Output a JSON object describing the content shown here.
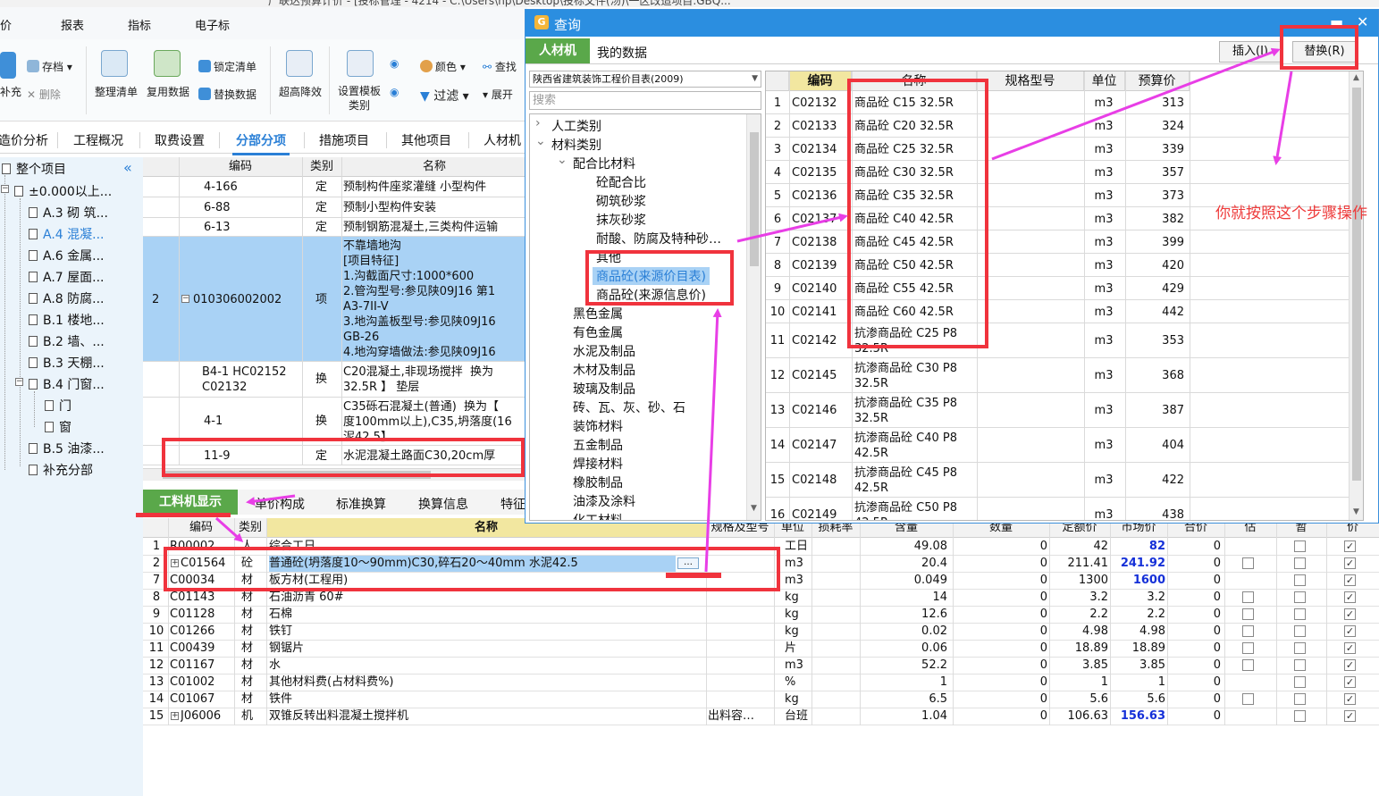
{
  "window_title": "广联达预算计价 - [投标管理 - 4214 - C:\\Users\\hp\\Desktop\\投标文件(汤)\\一区改造项目.GBQ...",
  "menu": [
    "价",
    "报表",
    "指标",
    "电子标"
  ],
  "ribbon": {
    "add": "补充",
    "save": "存档",
    "delete": "删除",
    "organize": "整理清单",
    "reuse": "复用数据",
    "lock": "锁定清单",
    "replace_data": "替换数据",
    "superior": "超高降效",
    "template": "设置模板\n类别",
    "color": "颜色",
    "filter": "过滤",
    "find": "查找",
    "expand": "展开"
  },
  "tabs": [
    "造价分析",
    "工程概况",
    "取费设置",
    "分部分项",
    "措施项目",
    "其他项目",
    "人材机"
  ],
  "active_tab": "分部分项",
  "tree": {
    "root": "整个项目",
    "items": [
      {
        "label": "±0.000以上..."
      },
      {
        "label": "A.3 砌 筑..."
      },
      {
        "label": "A.4 混凝..."
      },
      {
        "label": "A.6 金属..."
      },
      {
        "label": "A.7 屋面..."
      },
      {
        "label": "A.8 防腐..."
      },
      {
        "label": "B.1 楼地..."
      },
      {
        "label": "B.2 墙、..."
      },
      {
        "label": "B.3 天棚..."
      },
      {
        "label": "B.4 门窗..."
      },
      {
        "label": "门"
      },
      {
        "label": "窗"
      },
      {
        "label": "B.5 油漆..."
      },
      {
        "label": "补充分部"
      }
    ]
  },
  "center_grid": {
    "headers": [
      "编码",
      "类别",
      "名称"
    ],
    "rows": [
      {
        "no": "",
        "code": "4-166",
        "type": "定",
        "name": "预制构件座浆灌缝 小型构件"
      },
      {
        "no": "",
        "code": "6-88",
        "type": "定",
        "name": "预制小型构件安装"
      },
      {
        "no": "",
        "code": "6-13",
        "type": "定",
        "name": "预制钢筋混凝土,三类构件运输"
      },
      {
        "no": "2",
        "code": "010306002002",
        "type": "项",
        "name": "不靠墙地沟\n[项目特征]\n1.沟截面尺寸:1000*600\n2.管沟型号:参见陕09J16 第1\nA3-7II-V\n3.地沟盖板型号:参见陕09J16\nGB-26\n4.地沟穿墙做法:参见陕09J16"
      },
      {
        "no": "",
        "code": "B4-1 HC02152\nC02132",
        "type": "换",
        "name": "C20混凝土,非现场搅拌  换为\n32.5R 】 垫层"
      },
      {
        "no": "",
        "code": "4-1",
        "type": "换",
        "name": "C35砾石混凝土(普通)  换为【\n度100mm以上),C35,坍落度(16\n泥42.5】"
      },
      {
        "no": "",
        "code": "11-9",
        "type": "定",
        "name": "水泥混凝土路面C30,20cm厚"
      }
    ]
  },
  "bottom_tabs": [
    "工料机显示",
    "单价构成",
    "标准换算",
    "换算信息",
    "特征"
  ],
  "bottom_grid": {
    "headers": [
      "编码",
      "类别",
      "名称",
      "规格及型号",
      "单位",
      "损耗率",
      "含量",
      "数量",
      "定额价",
      "市场价",
      "合价",
      "估",
      "暂",
      "价"
    ],
    "rows": [
      {
        "no": "1",
        "code": "R00002",
        "type": "人",
        "name": "综合工日",
        "spec": "",
        "unit": "工日",
        "qty": "49.08",
        "amount": "0",
        "price": "42",
        "market": "82",
        "market_blue": true,
        "total": "0"
      },
      {
        "no": "2",
        "code": "C01564",
        "type": "砼",
        "name": "普通砼(坍落度10～90mm)C30,碎石20～40mm 水泥42.5",
        "spec": "",
        "unit": "m3",
        "qty": "20.4",
        "amount": "0",
        "price": "211.41",
        "market": "241.92",
        "market_blue": true,
        "total": "0"
      },
      {
        "no": "7",
        "code": "C00034",
        "type": "材",
        "name": "板方材(工程用)",
        "spec": "",
        "unit": "m3",
        "qty": "0.049",
        "amount": "0",
        "price": "1300",
        "market": "1600",
        "market_blue": true,
        "total": "0"
      },
      {
        "no": "8",
        "code": "C01143",
        "type": "材",
        "name": "石油沥青 60#",
        "spec": "",
        "unit": "kg",
        "qty": "14",
        "amount": "0",
        "price": "3.2",
        "market": "3.2",
        "market_blue": false,
        "total": "0"
      },
      {
        "no": "9",
        "code": "C01128",
        "type": "材",
        "name": "石棉",
        "spec": "",
        "unit": "kg",
        "qty": "12.6",
        "amount": "0",
        "price": "2.2",
        "market": "2.2",
        "market_blue": false,
        "total": "0"
      },
      {
        "no": "10",
        "code": "C01266",
        "type": "材",
        "name": "铁钉",
        "spec": "",
        "unit": "kg",
        "qty": "0.02",
        "amount": "0",
        "price": "4.98",
        "market": "4.98",
        "market_blue": false,
        "total": "0"
      },
      {
        "no": "11",
        "code": "C00439",
        "type": "材",
        "name": "钢锯片",
        "spec": "",
        "unit": "片",
        "qty": "0.06",
        "amount": "0",
        "price": "18.89",
        "market": "18.89",
        "market_blue": false,
        "total": "0"
      },
      {
        "no": "12",
        "code": "C01167",
        "type": "材",
        "name": "水",
        "spec": "",
        "unit": "m3",
        "qty": "52.2",
        "amount": "0",
        "price": "3.85",
        "market": "3.85",
        "market_blue": false,
        "total": "0"
      },
      {
        "no": "13",
        "code": "C01002",
        "type": "材",
        "name": "其他材料费(占材料费%)",
        "spec": "",
        "unit": "%",
        "qty": "1",
        "amount": "0",
        "price": "1",
        "market": "1",
        "market_blue": false,
        "total": "0"
      },
      {
        "no": "14",
        "code": "C01067",
        "type": "材",
        "name": "铁件",
        "spec": "",
        "unit": "kg",
        "qty": "6.5",
        "amount": "0",
        "price": "5.6",
        "market": "5.6",
        "market_blue": false,
        "total": "0"
      },
      {
        "no": "15",
        "code": "J06006",
        "type": "机",
        "name": "双锥反转出料混凝土搅拌机",
        "spec": "出料容…",
        "unit": "台班",
        "qty": "1.04",
        "amount": "0",
        "price": "106.63",
        "market": "156.63",
        "market_blue": true,
        "total": "0"
      }
    ],
    "ellipsis": "…"
  },
  "dialog": {
    "title": "查询",
    "tabs": [
      "人材机",
      "我的数据"
    ],
    "insert_label": "插入(I)",
    "replace_label": "替换(R)",
    "price_book": "陕西省建筑装饰工程价目表(2009)",
    "search_placeholder": "搜索",
    "tree": [
      {
        "label": "人工类别"
      },
      {
        "label": "材料类别"
      },
      {
        "label": "配合比材料"
      },
      {
        "label": "砼配合比"
      },
      {
        "label": "砌筑砂浆"
      },
      {
        "label": "抹灰砂浆"
      },
      {
        "label": "耐酸、防腐及特种砂…"
      },
      {
        "label": "其他"
      },
      {
        "label": "商品砼(来源价目表)"
      },
      {
        "label": "商品砼(来源信息价)"
      },
      {
        "label": "黑色金属"
      },
      {
        "label": "有色金属"
      },
      {
        "label": "水泥及制品"
      },
      {
        "label": "木材及制品"
      },
      {
        "label": "玻璃及制品"
      },
      {
        "label": "砖、瓦、灰、砂、石"
      },
      {
        "label": "装饰材料"
      },
      {
        "label": "五金制品"
      },
      {
        "label": "焊接材料"
      },
      {
        "label": "橡胶制品"
      },
      {
        "label": "油漆及涂料"
      },
      {
        "label": "化工材料"
      }
    ],
    "grid_headers": [
      "编码",
      "名称",
      "规格型号",
      "单位",
      "预算价"
    ],
    "rows": [
      {
        "no": "1",
        "code": "C02132",
        "name": "商品砼 C15 32.5R",
        "unit": "m3",
        "price": "313"
      },
      {
        "no": "2",
        "code": "C02133",
        "name": "商品砼 C20 32.5R",
        "unit": "m3",
        "price": "324"
      },
      {
        "no": "3",
        "code": "C02134",
        "name": "商品砼 C25 32.5R",
        "unit": "m3",
        "price": "339"
      },
      {
        "no": "4",
        "code": "C02135",
        "name": "商品砼 C30 32.5R",
        "unit": "m3",
        "price": "357"
      },
      {
        "no": "5",
        "code": "C02136",
        "name": "商品砼 C35 32.5R",
        "unit": "m3",
        "price": "373"
      },
      {
        "no": "6",
        "code": "C02137",
        "name": "商品砼 C40 42.5R",
        "unit": "m3",
        "price": "382"
      },
      {
        "no": "7",
        "code": "C02138",
        "name": "商品砼 C45 42.5R",
        "unit": "m3",
        "price": "399"
      },
      {
        "no": "8",
        "code": "C02139",
        "name": "商品砼 C50 42.5R",
        "unit": "m3",
        "price": "420"
      },
      {
        "no": "9",
        "code": "C02140",
        "name": "商品砼 C55 42.5R",
        "unit": "m3",
        "price": "429"
      },
      {
        "no": "10",
        "code": "C02141",
        "name": "商品砼 C60 42.5R",
        "unit": "m3",
        "price": "442"
      },
      {
        "no": "11",
        "code": "C02142",
        "name": "抗渗商品砼 C25 P8\n32.5R",
        "unit": "m3",
        "price": "353"
      },
      {
        "no": "12",
        "code": "C02145",
        "name": "抗渗商品砼 C30 P8\n32.5R",
        "unit": "m3",
        "price": "368"
      },
      {
        "no": "13",
        "code": "C02146",
        "name": "抗渗商品砼 C35 P8\n32.5R",
        "unit": "m3",
        "price": "387"
      },
      {
        "no": "14",
        "code": "C02147",
        "name": "抗渗商品砼 C40 P8\n42.5R",
        "unit": "m3",
        "price": "404"
      },
      {
        "no": "15",
        "code": "C02148",
        "name": "抗渗商品砼 C45 P8\n42.5R",
        "unit": "m3",
        "price": "422"
      },
      {
        "no": "16",
        "code": "C02149",
        "name": "抗渗商品砼 C50 P8\n42.5R",
        "unit": "m3",
        "price": "438"
      }
    ]
  },
  "annotation_note": "你就按照这个步骤操作",
  "colors": {
    "accent_blue": "#2a7fd6",
    "green_tab": "#5aa84a",
    "annotation_red": "#f0333d",
    "annotation_magenta": "#e83ee6",
    "selection_blue": "#a9d2f5",
    "dialog_title": "#2b8ee0"
  }
}
